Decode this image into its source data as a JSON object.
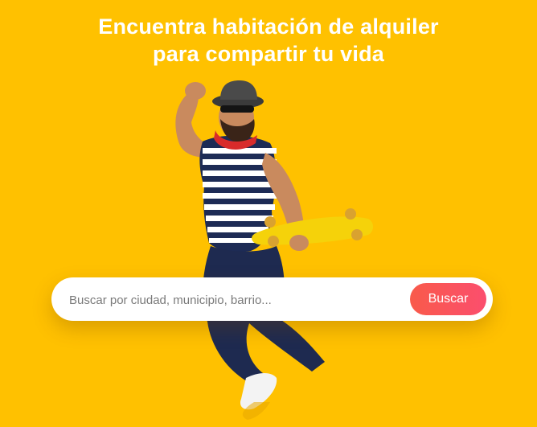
{
  "hero": {
    "title_line1": "Encuentra habitación de alquiler",
    "title_line2": "para compartir tu vida",
    "background_color": "#ffc100"
  },
  "search": {
    "placeholder": "Buscar por ciudad, municipio, barrio...",
    "value": "",
    "button_label": "Buscar",
    "button_color": "#f95a4a"
  }
}
